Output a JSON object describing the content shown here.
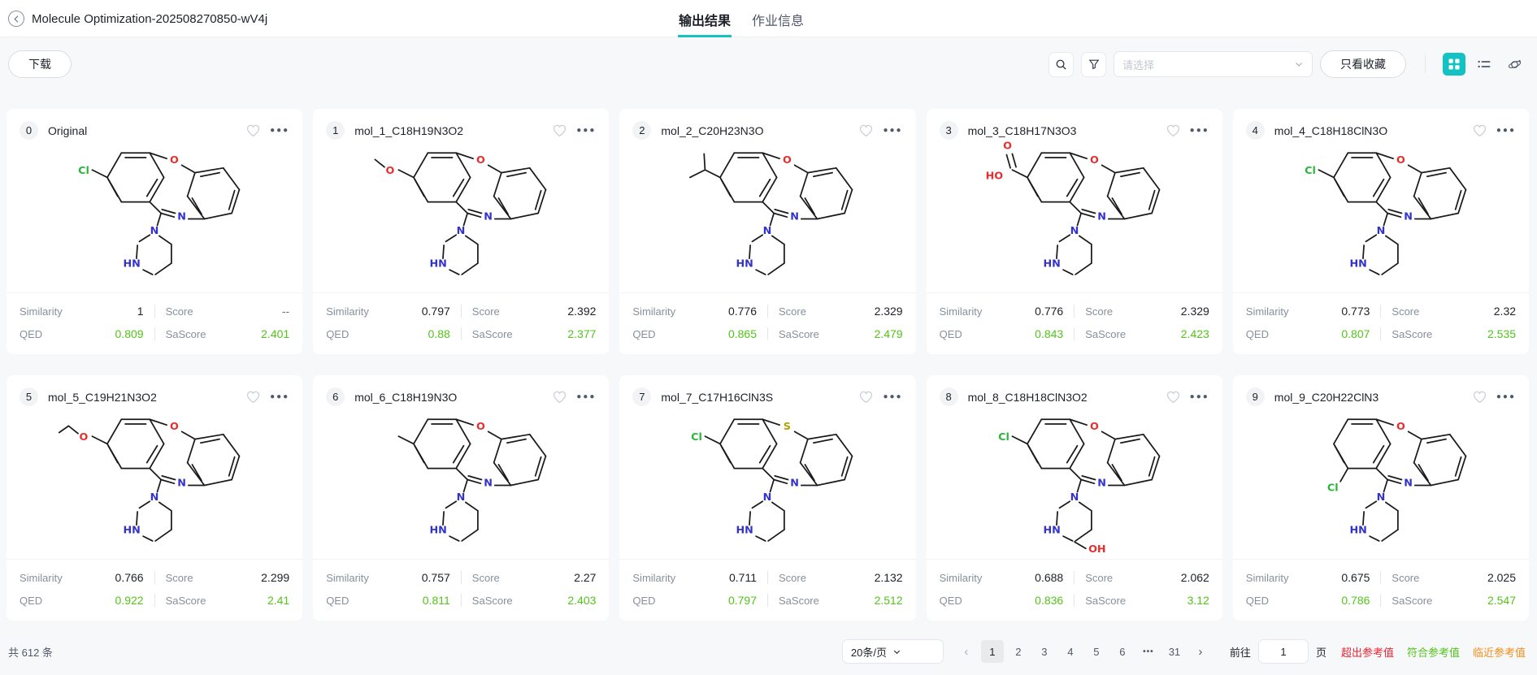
{
  "topbar": {
    "title": "Molecule Optimization-202508270850-wV4j",
    "tabs": [
      {
        "label": "输出结果",
        "active": true
      },
      {
        "label": "作业信息",
        "active": false
      }
    ]
  },
  "toolbar": {
    "download_label": "下载",
    "select_placeholder": "请选择",
    "favorites_label": "只看收藏"
  },
  "stats_labels": {
    "similarity": "Similarity",
    "score": "Score",
    "qed": "QED",
    "sascore": "SaScore"
  },
  "molecule_common": {
    "ring_n": "N",
    "ring_hn": "HN"
  },
  "molecule_colors": {
    "bond": "#1a1a1a",
    "N": "#3333cc",
    "O": "#e62e2e",
    "Cl": "#2db43c",
    "S": "#b0a000"
  },
  "cards": [
    {
      "index": "0",
      "name": "Original",
      "similarity": "1",
      "score": "--",
      "qed": "0.809",
      "sascore": "2.401",
      "mol": {
        "sub": "Cl"
      }
    },
    {
      "index": "1",
      "name": "mol_1_C18H19N3O2",
      "similarity": "0.797",
      "score": "2.392",
      "qed": "0.88",
      "sascore": "2.377",
      "mol": {
        "sub": "O",
        "tail": 1
      }
    },
    {
      "index": "2",
      "name": "mol_2_C20H23N3O",
      "similarity": "0.776",
      "score": "2.329",
      "qed": "0.865",
      "sascore": "2.479",
      "mol": {
        "iso": true
      }
    },
    {
      "index": "3",
      "name": "mol_3_C18H17N3O3",
      "similarity": "0.776",
      "score": "2.329",
      "qed": "0.843",
      "sascore": "2.423",
      "mol": {
        "cooh": true,
        "cooh_o": "O",
        "cooh_ho": "HO"
      }
    },
    {
      "index": "4",
      "name": "mol_4_C18H18ClN3O",
      "similarity": "0.773",
      "score": "2.32",
      "qed": "0.807",
      "sascore": "2.535",
      "mol": {
        "sub": "Cl"
      }
    },
    {
      "index": "5",
      "name": "mol_5_C19H21N3O2",
      "similarity": "0.766",
      "score": "2.299",
      "qed": "0.922",
      "sascore": "2.41",
      "mol": {
        "sub": "O",
        "tail": 2
      }
    },
    {
      "index": "6",
      "name": "mol_6_C18H19N3O",
      "similarity": "0.757",
      "score": "2.27",
      "qed": "0.811",
      "sascore": "2.403",
      "mol": {
        "methyl": true
      }
    },
    {
      "index": "7",
      "name": "mol_7_C17H16ClN3S",
      "similarity": "0.711",
      "score": "2.132",
      "qed": "0.797",
      "sascore": "2.512",
      "mol": {
        "sub": "Cl",
        "bridge": "S"
      }
    },
    {
      "index": "8",
      "name": "mol_8_C18H18ClN3O2",
      "similarity": "0.688",
      "score": "2.062",
      "qed": "0.836",
      "sascore": "3.12",
      "mol": {
        "sub": "Cl",
        "extra": "OH"
      }
    },
    {
      "index": "9",
      "name": "mol_9_C20H22ClN3",
      "similarity": "0.675",
      "score": "2.025",
      "qed": "0.786",
      "sascore": "2.547",
      "mol": {
        "sub": "Cl",
        "sub_pos": "bottom"
      }
    }
  ],
  "footer": {
    "total": "共 612 条",
    "page_size": "20条/页",
    "prev_icon": "‹",
    "next_icon": "›",
    "pages": [
      "1",
      "2",
      "3",
      "4",
      "5",
      "6"
    ],
    "more_icon": "•••",
    "last_page": "31",
    "active_page": "1",
    "goto_label": "前往",
    "goto_value": "1",
    "goto_suffix": "页",
    "legend": [
      {
        "label": "超出参考值",
        "color": "#f5222d"
      },
      {
        "label": "符合参考值",
        "color": "#52c41a"
      },
      {
        "label": "临近参考值",
        "color": "#fa8c16"
      }
    ]
  }
}
